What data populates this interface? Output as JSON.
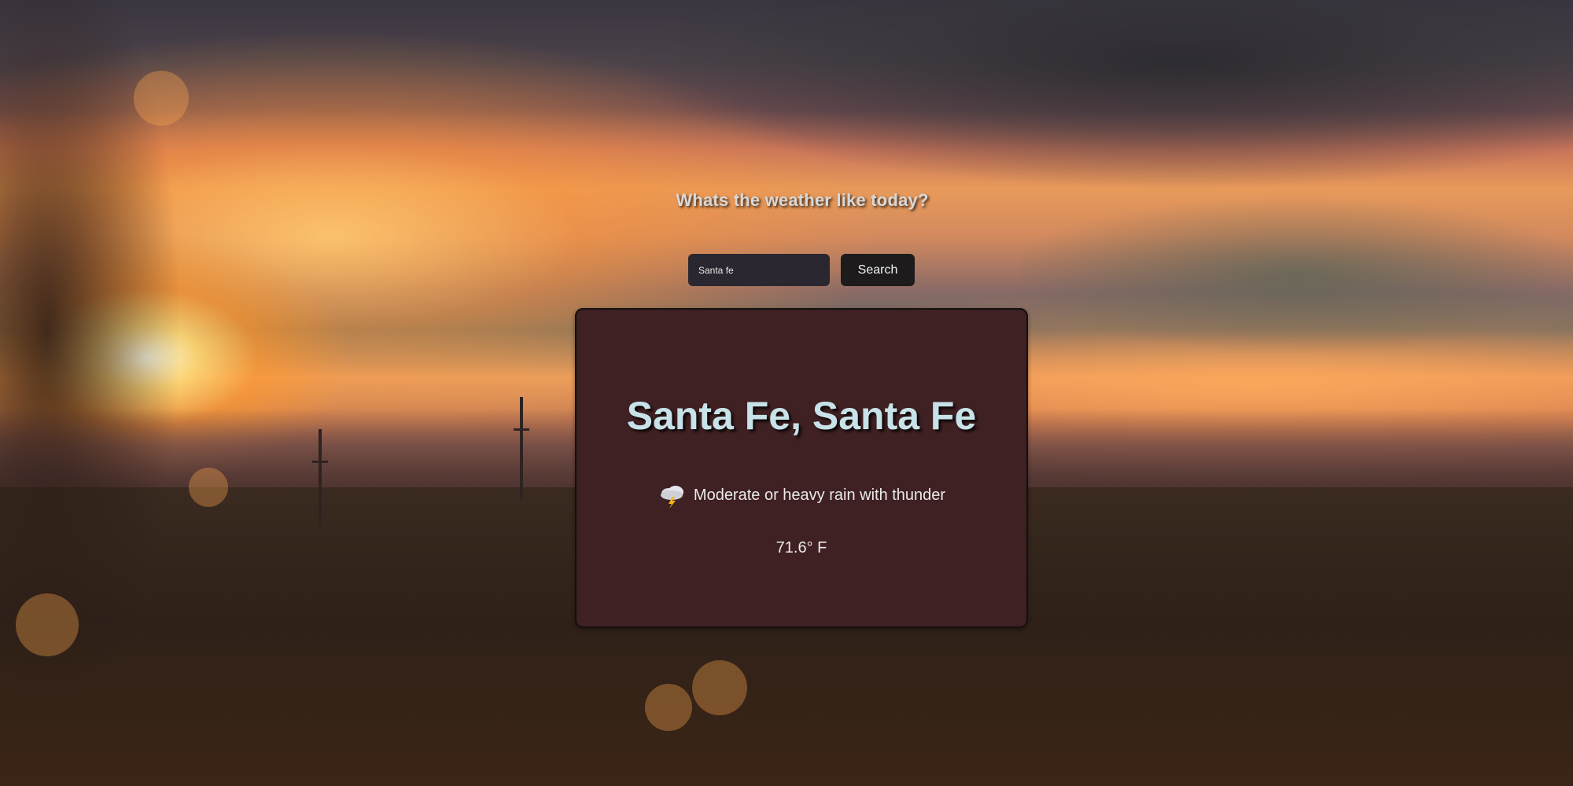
{
  "page": {
    "headline": "Whats the weather like today?"
  },
  "search": {
    "value": "Santa fe",
    "placeholder": "",
    "button_label": "Search"
  },
  "weather": {
    "location": "Santa Fe, Santa Fe",
    "condition": "Moderate or heavy rain with thunder",
    "condition_icon": "thunderstorm-cloud-icon",
    "temperature": "71.6° F"
  },
  "colors": {
    "card_background": "#3f2023",
    "city_text": "#c7e2e8",
    "button_background": "#1d1b1b",
    "input_background": "#2a2730"
  }
}
